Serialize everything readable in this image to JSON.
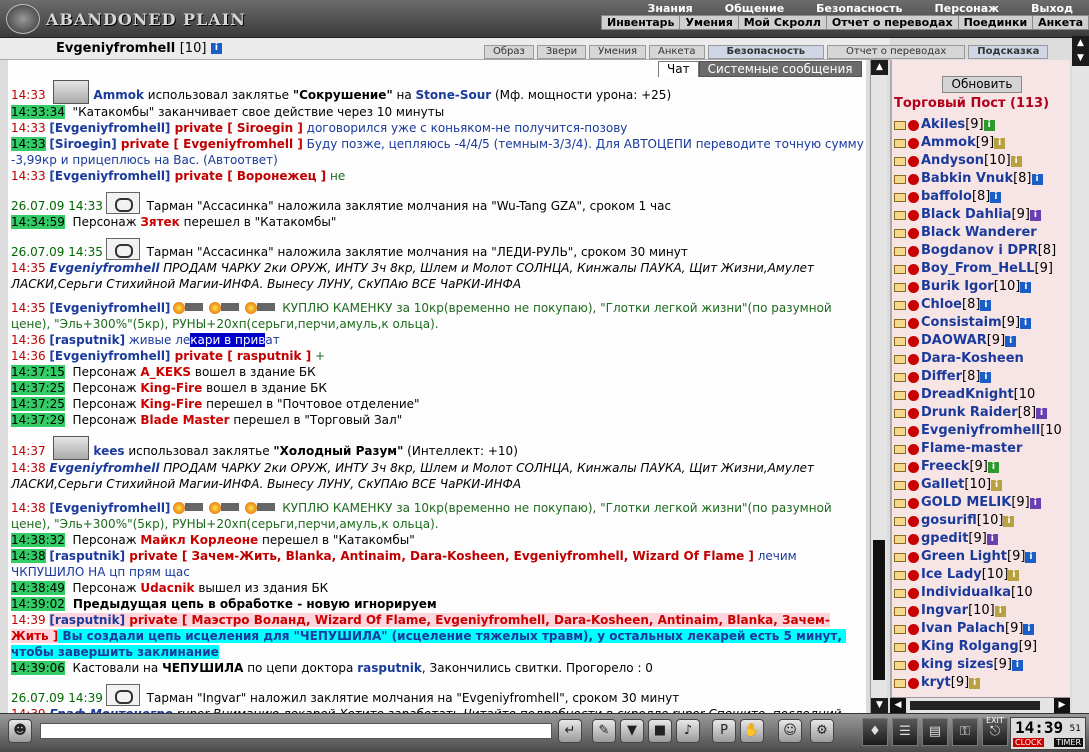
{
  "app": {
    "logo_text": "ABANDONED PLAIN"
  },
  "menu_top": [
    "Знания",
    "Общение",
    "Безопасность",
    "Персонаж",
    "Выход"
  ],
  "menu_sub": [
    "Инвентарь",
    "Умения",
    "Мой Скролл",
    "Отчет о переводах",
    "Поединки",
    "Анкета"
  ],
  "user": {
    "name": "Evgeniyfromhell",
    "level": "[10]"
  },
  "top_tabs": [
    "Образ",
    "Звери",
    "Умения",
    "Анкета",
    "Безопасность",
    "Отчет о переводах",
    "Подсказка"
  ],
  "chat_tabs": [
    "Чат",
    "Системные сообщения"
  ],
  "chat": [
    {
      "kind": "a",
      "time": "14:33",
      "actor": "Ammok",
      "txt1": " использовал заклятье ",
      "bold": "\"Сокрушение\"",
      "txt2": " на ",
      "target": "Stone-Sour",
      "txt3": " (Мф. мощности урона: +25)"
    },
    {
      "kind": "s",
      "time": "14:33:34",
      "msg": " \"Катакомбы\" заканчивает свое действие через 10 минуты"
    },
    {
      "kind": "p",
      "time": "14:33",
      "from": "[Evgeniyfromhell]",
      "priv": " private [ Siroegin ]",
      "msg": " договорился уже с коньяком-не получится-позову",
      "msgclass": "btxt"
    },
    {
      "kind": "p",
      "time": "14:33",
      "timehl": true,
      "from": "[Siroegin]",
      "priv": " private [ Evgeniyfromhell ]",
      "msg": " Буду позже, цепляюсь -4/4/5 (темным-3/3/4). Для АВТОЦЕПИ переводите точную сумму -3,99кр и прицеплюсь на Вас. (Автоответ)",
      "msgclass": "btxt"
    },
    {
      "kind": "p",
      "time": "14:33",
      "from": "[Evgeniyfromhell]",
      "priv": " private [ Воронежец ]",
      "msg": " не",
      "msgclass": "gtxt"
    },
    {
      "kind": "gap"
    },
    {
      "kind": "m",
      "date": "26.07.09 14:33",
      "msg": " Тарман \"Ассасинка\" наложила заклятие молчания на \"Wu-Tang GZA\", сроком 1 час"
    },
    {
      "kind": "e",
      "time": "14:34:59",
      "pre": " Персонаж ",
      "nick": "Зятек",
      "post": " перешел в \"Катакомбы\""
    },
    {
      "kind": "gap"
    },
    {
      "kind": "m",
      "date": "26.07.09 14:35",
      "msg": " Тарман \"Ассасинка\" наложила заклятие молчания на \"ЛЕДИ-РУЛЬ\", сроком 30 минут"
    },
    {
      "kind": "t",
      "time": "14:35",
      "actor": "Evgeniyfromhell",
      "msg": " ПРОДАМ ЧАРКУ 2ки ОРУЖ, ИНТУ 3ч 8кр, Шлем и Молот СОЛНЦА, Кинжалы ПАУКА, Щит Жизни,Амулет ЛАСКИ,Серьги Стихийной Магии-ИНФА. Вынесу ЛУНУ, СкУПАю ВСЕ ЧаРКИ-ИНФА"
    },
    {
      "kind": "gap"
    },
    {
      "kind": "b",
      "time": "14:35",
      "from": "[Evgeniyfromhell]",
      "msg": " КУПЛЮ КАМЕНКУ за 10кр(временно не покупаю), \"Глотки легкой жизни\"(по разумной цене), \"Эль+300%\"(5кр), РУНЫ+20хп(серьги,перчи,амуль,к ольца)."
    },
    {
      "kind": "r",
      "time": "14:36",
      "from": "[rasputnik]",
      "pre": " живые ле",
      "selected": "кари в прив",
      "post": "ат"
    },
    {
      "kind": "p",
      "time": "14:36",
      "from": "[Evgeniyfromhell]",
      "priv": " private [ rasputnik ]",
      "msg": " +",
      "msgclass": "gtxt"
    },
    {
      "kind": "e",
      "time": "14:37:15",
      "pre": " Персонаж ",
      "nick": "A_KEKS",
      "post": " вошел в здание БК"
    },
    {
      "kind": "e",
      "time": "14:37:25",
      "pre": " Персонаж ",
      "nick": "King-Fire",
      "post": " вошел в здание БК"
    },
    {
      "kind": "e",
      "time": "14:37:25",
      "pre": " Персонаж ",
      "nick": "King-Fire",
      "post": " перешел в \"Почтовое отделение\""
    },
    {
      "kind": "e",
      "time": "14:37:29",
      "pre": " Персонаж ",
      "nick": "Blade Master",
      "post": " перешел в \"Торговый Зал\""
    },
    {
      "kind": "gap"
    },
    {
      "kind": "a",
      "time": "14:37",
      "actor": "kees",
      "txt1": " использовал заклятье ",
      "bold": "\"Холодный Разум\"",
      "txt2": "",
      "target": "",
      "txt3": " (Интеллект: +10)"
    },
    {
      "kind": "t",
      "time": "14:38",
      "actor": "Evgeniyfromhell",
      "msg": " ПРОДАМ ЧАРКУ 2ки ОРУЖ, ИНТУ 3ч 8кр, Шлем и Молот СОЛНЦА, Кинжалы ПАУКА, Щит Жизни,Амулет ЛАСКИ,Серьги Стихийной Магии-ИНФА. Вынесу ЛУНУ, СкУПАю ВСЕ ЧаРКИ-ИНФА"
    },
    {
      "kind": "gap"
    },
    {
      "kind": "b",
      "time": "14:38",
      "from": "[Evgeniyfromhell]",
      "msg": " КУПЛЮ КАМЕНКУ за 10кр(временно не покупаю), \"Глотки легкой жизни\"(по разумной цене), \"Эль+300%\"(5кр), РУНЫ+20хп(серьги,перчи,амуль,к ольца)."
    },
    {
      "kind": "e",
      "time": "14:38:32",
      "pre": " Персонаж ",
      "nick": "Майкл Корлеоне",
      "post": " перешел в \"Катакомбы\""
    },
    {
      "kind": "p",
      "time": "14:38",
      "timehl": true,
      "from": "[rasputnik]",
      "priv": " private [ Зачем-Жить, Blanka, Antinaim, Dara-Kosheen, Evgeniyfromhell, Wizard Of Flame ]",
      "msg": " лечим ЧКПУШИЛО НА цп прям щас",
      "msgclass": "btxt"
    },
    {
      "kind": "e",
      "time": "14:38:49",
      "pre": " Персонаж ",
      "nick": "Udacnik",
      "post": " вышел из здания БК"
    },
    {
      "kind": "k",
      "time": "14:39:02",
      "msg": " Предыдущая цепь в обработке - новую игнорируем"
    },
    {
      "kind": "c",
      "time": "14:39",
      "from": "[rasputnik]",
      "priv": " private [ Маэстро Воланд, Wizard Of Flame, Evgeniyfromhell, Dara-Kosheen, Antinaim, Blanka, Зачем-Жить ]",
      "msg": " Вы создали цепь исцеления для \"ЧЕПУШИЛА\" (исцеление тяжелых травм), у остальных лекарей есть 5 минут, чтобы завершить заклинание"
    },
    {
      "kind": "h",
      "time": "14:39:06",
      "pre": " Кастовали на ",
      "b1": "ЧЕПУШИЛА",
      "mid": " по цепи доктора ",
      "b2": "rasputnik",
      "post": ", Закончились свитки. Прогорело : 0"
    },
    {
      "kind": "gap"
    },
    {
      "kind": "m",
      "date": "26.07.09 14:39",
      "msg": " Тарман \"Ingvar\" наложил заклятие молчания на \"Evgeniyfromhell\", сроком 30 минут"
    },
    {
      "kind": "t",
      "time": "14:39",
      "actor": "Граф Монтенегро",
      "msg": " rupor Вниманию лекарей Хотите заработать Читайте подробности в скролле rupor Спешите, последний день регистрации"
    }
  ],
  "side": {
    "refresh_label": "Обновить",
    "title": "Торговый Пост (113)",
    "players": [
      {
        "name": "Akiles",
        "level": "[9]",
        "badge": "gr"
      },
      {
        "name": "Ammok",
        "level": "[9]",
        "badge": "g"
      },
      {
        "name": "Andyson",
        "level": "[10]",
        "badge": "g"
      },
      {
        "name": "Babkin Vnuk",
        "level": "[8]",
        "badge": "i"
      },
      {
        "name": "baffolo",
        "level": "[8]",
        "badge": "i"
      },
      {
        "name": "Black Dahlia",
        "level": "[9]",
        "badge": "p"
      },
      {
        "name": "Black Wanderer",
        "level": "",
        "badge": ""
      },
      {
        "name": "Bogdanov i DPR",
        "level": "[8]",
        "badge": ""
      },
      {
        "name": "Boy_From_HeLL",
        "level": "[9]",
        "badge": ""
      },
      {
        "name": "Burik Igor",
        "level": "[10]",
        "badge": "i"
      },
      {
        "name": "Chloe",
        "level": "[8]",
        "badge": "i"
      },
      {
        "name": "Consistaim",
        "level": "[9]",
        "badge": "i"
      },
      {
        "name": "DAOWAR",
        "level": "[9]",
        "badge": "i"
      },
      {
        "name": "Dara-Kosheen",
        "level": "",
        "badge": ""
      },
      {
        "name": "Differ",
        "level": "[8]",
        "badge": "i"
      },
      {
        "name": "DreadKnight",
        "level": "[10",
        "badge": ""
      },
      {
        "name": "Drunk Raider",
        "level": "[8]",
        "badge": "p"
      },
      {
        "name": "Evgeniyfromhell",
        "level": "[10",
        "badge": ""
      },
      {
        "name": "Flame-master",
        "level": "",
        "badge": ""
      },
      {
        "name": "Freeck",
        "level": "[9]",
        "badge": "gr"
      },
      {
        "name": "Gallet",
        "level": "[10]",
        "badge": "g"
      },
      {
        "name": "GOLD MELIK",
        "level": "[9]",
        "badge": "p"
      },
      {
        "name": "gosurifl",
        "level": "[10]",
        "badge": "g"
      },
      {
        "name": "gpedit",
        "level": "[9]",
        "badge": "p"
      },
      {
        "name": "Green Light",
        "level": "[9]",
        "badge": "i"
      },
      {
        "name": "Ice Lady",
        "level": "[10]",
        "badge": "g"
      },
      {
        "name": "Individualka",
        "level": "[10",
        "badge": ""
      },
      {
        "name": "Ingvar",
        "level": "[10]",
        "badge": "g"
      },
      {
        "name": "Ivan Palach",
        "level": "[9]",
        "badge": "i"
      },
      {
        "name": "King Rolgang",
        "level": "[9]",
        "badge": ""
      },
      {
        "name": "king sizes",
        "level": "[9]",
        "badge": "i"
      },
      {
        "name": "kryt",
        "level": "[9]",
        "badge": "g"
      }
    ]
  },
  "clock": {
    "time": "14:39",
    "sec": "51",
    "label_clock": "CLOCK",
    "label_timer": "TIMER",
    "exit": "EXIT"
  },
  "icons": {
    "info": "i"
  }
}
